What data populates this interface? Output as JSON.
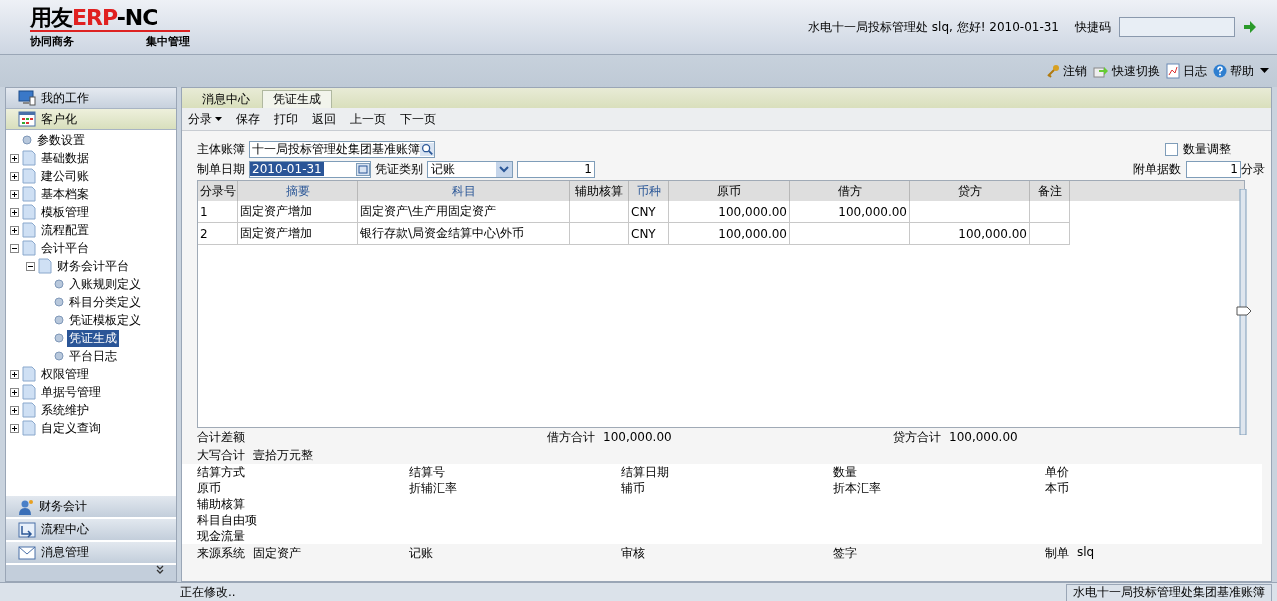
{
  "header": {
    "logo": {
      "brand": "用友",
      "product": "ERP",
      "suffix": "-NC",
      "tagline_left": "协同商务",
      "tagline_right": "集中管理"
    },
    "greeting": "水电十一局投标管理处 slq, 您好! 2010-01-31",
    "shortcut_label": "快捷码"
  },
  "top_links": [
    "注销",
    "快速切换",
    "日志",
    "帮助"
  ],
  "sidebar": {
    "sections": [
      {
        "label": "我的工作",
        "selected": false
      },
      {
        "label": "客户化",
        "selected": true
      }
    ],
    "tree": [
      {
        "label": "参数设置"
      },
      {
        "label": "基础数据",
        "expanded": false
      },
      {
        "label": "建公司账",
        "expanded": false
      },
      {
        "label": "基本档案",
        "expanded": false
      },
      {
        "label": "模板管理",
        "expanded": false
      },
      {
        "label": "流程配置",
        "expanded": false
      },
      {
        "label": "会计平台",
        "expanded": true,
        "children": [
          {
            "label": "财务会计平台",
            "expanded": true,
            "children": [
              {
                "label": "入账规则定义",
                "selected": false
              },
              {
                "label": "科目分类定义",
                "selected": false
              },
              {
                "label": "凭证模板定义",
                "selected": false
              },
              {
                "label": "凭证生成",
                "selected": true
              },
              {
                "label": "平台日志",
                "selected": false
              }
            ]
          }
        ]
      },
      {
        "label": "权限管理",
        "expanded": false
      },
      {
        "label": "单据号管理",
        "expanded": false
      },
      {
        "label": "系统维护",
        "expanded": false
      },
      {
        "label": "自定义查询",
        "expanded": false
      }
    ],
    "modules": [
      "财务会计",
      "流程中心",
      "消息管理"
    ]
  },
  "tabs": [
    {
      "label": "消息中心",
      "selected": false
    },
    {
      "label": "凭证生成",
      "selected": true
    }
  ],
  "toolbar": [
    {
      "label": "分录",
      "dropdown": true
    },
    {
      "label": "保存",
      "dropdown": false
    },
    {
      "label": "打印",
      "dropdown": false
    },
    {
      "label": "返回",
      "dropdown": false
    },
    {
      "label": "上一页",
      "dropdown": false
    },
    {
      "label": "下一页",
      "dropdown": false
    }
  ],
  "form": {
    "book_label": "主体账簿",
    "book_value": "十一局投标管理处集团基准账簿",
    "qty_adjust": {
      "label": "数量调整",
      "checked": false
    },
    "date_label": "制单日期",
    "date_value": "2010-01-31",
    "type_label": "凭证类别",
    "type_value": "记账",
    "voucher_no": "1",
    "attach_label": "附单据数",
    "attach_value": "1",
    "attach_unit": "分录"
  },
  "table": {
    "columns": [
      {
        "label": "分录号",
        "required": false
      },
      {
        "label": "摘要",
        "required": true
      },
      {
        "label": "科目",
        "required": true
      },
      {
        "label": "辅助核算",
        "required": false
      },
      {
        "label": "币种",
        "required": true
      },
      {
        "label": "原币",
        "required": false
      },
      {
        "label": "借方",
        "required": false
      },
      {
        "label": "贷方",
        "required": false
      },
      {
        "label": "备注",
        "required": false
      }
    ],
    "rows": [
      [
        "1",
        "固定资产增加",
        "固定资产\\生产用固定资产",
        "",
        "CNY",
        "100,000.00",
        "100,000.00",
        "",
        ""
      ],
      [
        "2",
        "固定资产增加",
        "银行存款\\局资金结算中心\\外币",
        "",
        "CNY",
        "100,000.00",
        "",
        "100,000.00",
        ""
      ]
    ]
  },
  "totals": {
    "diff_label": "合计差额",
    "debit_label": "借方合计",
    "debit_value": "100,000.00",
    "credit_label": "贷方合计",
    "credit_value": "100,000.00",
    "caps_label": "大写合计",
    "caps_value": "壹拾万元整"
  },
  "details": [
    [
      {
        "label": "结算方式"
      },
      {
        "label": "结算号"
      },
      {
        "label": "结算日期"
      },
      {
        "label": "数量"
      },
      {
        "label": "单价"
      }
    ],
    [
      {
        "label": "原币"
      },
      {
        "label": "折辅汇率"
      },
      {
        "label": "辅币"
      },
      {
        "label": "折本汇率"
      },
      {
        "label": "本币"
      }
    ],
    [
      {
        "label": "辅助核算"
      }
    ],
    [
      {
        "label": "科目自由项"
      }
    ],
    [
      {
        "label": "现金流量"
      }
    ]
  ],
  "footer_fields": [
    {
      "label": "来源系统",
      "value": "固定资产"
    },
    {
      "label": "记账"
    },
    {
      "label": "审核"
    },
    {
      "label": "签字"
    },
    {
      "label": "制单",
      "value": "slq"
    }
  ],
  "status_bar": {
    "message": "正在修改..",
    "book": "水电十一局投标管理处集团基准账簿"
  }
}
